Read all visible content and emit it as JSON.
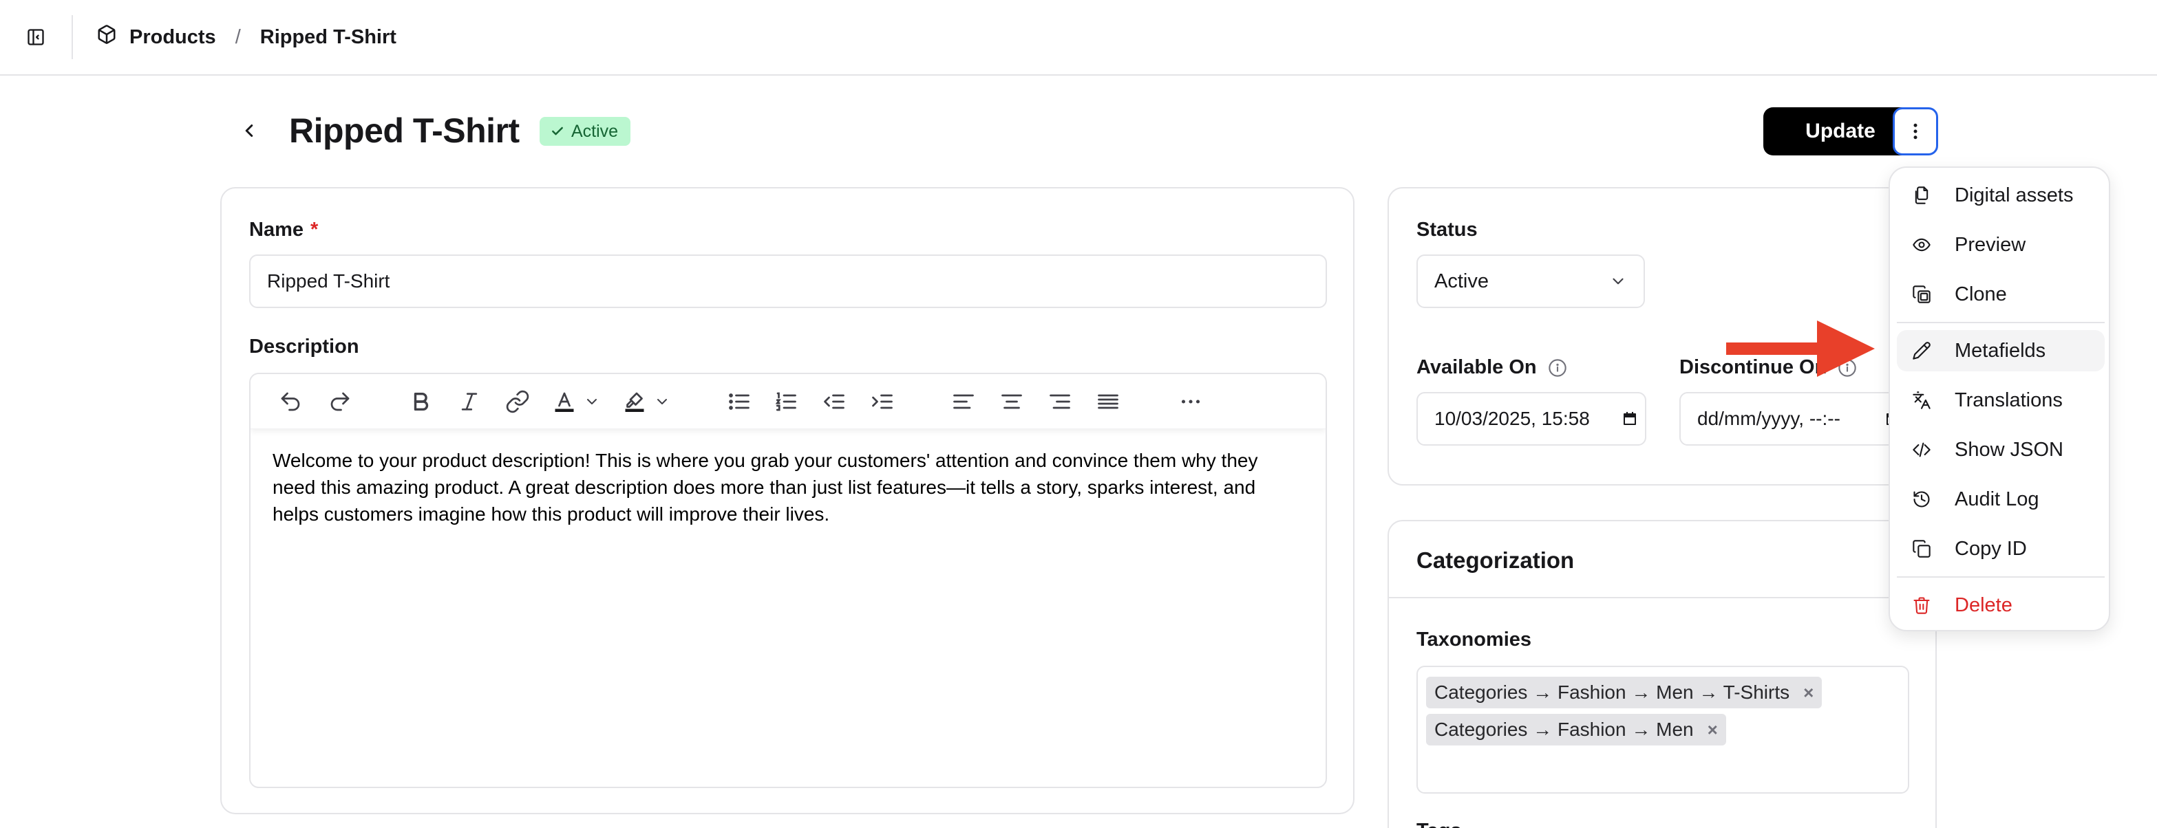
{
  "breadcrumb": {
    "parent": "Products",
    "separator": "/",
    "current": "Ripped T-Shirt"
  },
  "page": {
    "title": "Ripped T-Shirt",
    "status_badge": "Active",
    "update_label": "Update"
  },
  "product_form": {
    "name_label": "Name",
    "required_mark": "*",
    "name_value": "Ripped T-Shirt",
    "description_label": "Description",
    "description_text": "Welcome to your product description! This is where you grab your customers' attention and convince them why they need this amazing product. A great description does more than just list features—it tells a story, sparks interest, and helps customers imagine how this product will improve their lives.",
    "toolbar_icons": [
      "undo-icon",
      "redo-icon",
      "bold-icon",
      "italic-icon",
      "link-icon",
      "text-color-icon",
      "chevron-down-icon",
      "highlight-icon",
      "chevron-down-icon",
      "bullet-list-icon",
      "numbered-list-icon",
      "outdent-icon",
      "indent-icon",
      "align-left-icon",
      "align-center-icon",
      "align-right-icon",
      "align-justify-icon",
      "more-horizontal-icon"
    ]
  },
  "status_card": {
    "status_label": "Status",
    "status_value": "Active",
    "available_label": "Available On",
    "available_value": "10/03/2025, 15:58",
    "discontinue_label": "Discontinue On",
    "discontinue_value": "dd/mm/yyyy, --:--"
  },
  "categorization": {
    "title": "Categorization",
    "taxonomies_label": "Taxonomies",
    "taxonomies": [
      "Categories → Fashion → Men → T-Shirts",
      "Categories → Fashion → Men"
    ],
    "tags_label": "Tags"
  },
  "actions_menu": {
    "items": [
      {
        "label": "Digital assets",
        "icon": "files-icon"
      },
      {
        "label": "Preview",
        "icon": "eye-icon"
      },
      {
        "label": "Clone",
        "icon": "clone-icon"
      },
      {
        "label": "Metafields",
        "icon": "pencil-icon"
      },
      {
        "label": "Translations",
        "icon": "languages-icon"
      },
      {
        "label": "Show JSON",
        "icon": "code-icon"
      },
      {
        "label": "Audit Log",
        "icon": "history-icon"
      },
      {
        "label": "Copy ID",
        "icon": "copy-icon"
      },
      {
        "label": "Delete",
        "icon": "trash-icon"
      }
    ]
  },
  "colors": {
    "accent_blue": "#2563eb",
    "badge_green_bg": "#bbf7d0",
    "badge_green_text": "#166534",
    "danger": "#dc2626",
    "annotation_arrow": "#e8402a"
  }
}
